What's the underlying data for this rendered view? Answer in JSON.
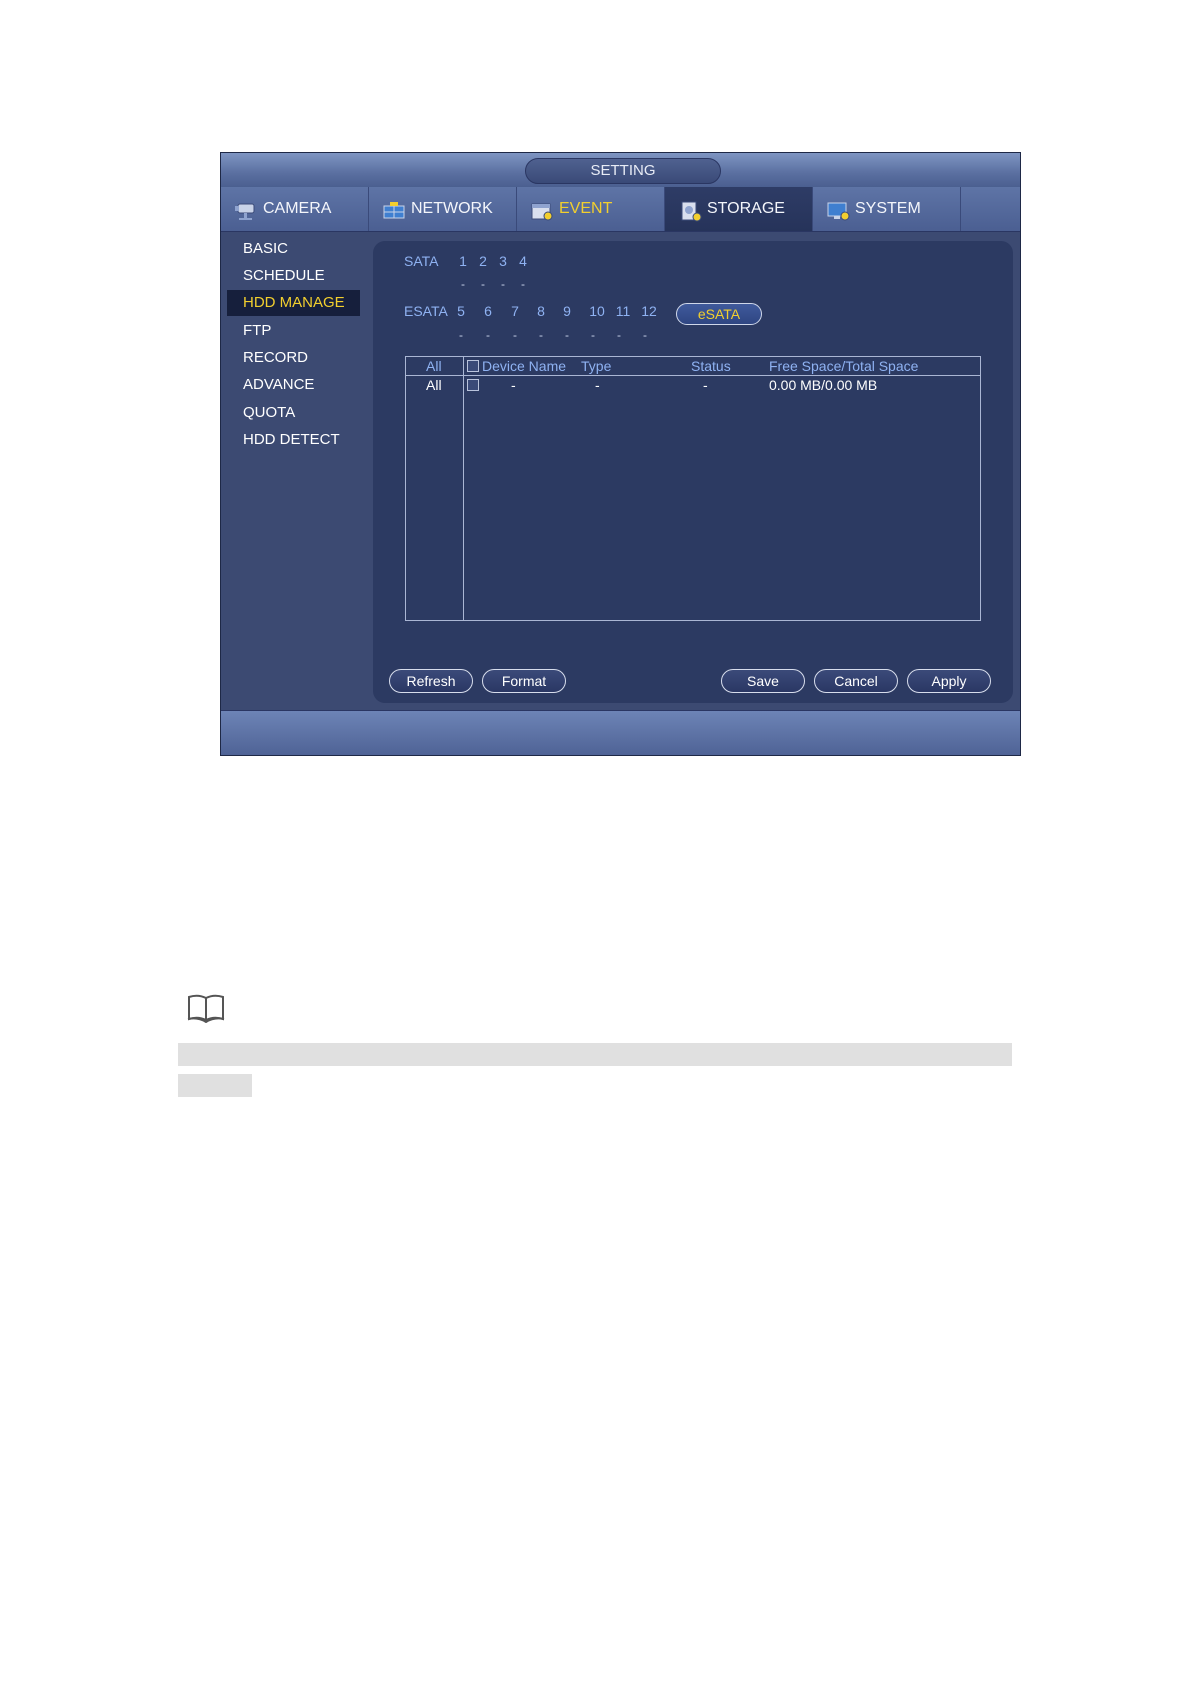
{
  "window": {
    "title": "SETTING"
  },
  "tabs": [
    {
      "label": "CAMERA",
      "icon": "camera-icon"
    },
    {
      "label": "NETWORK",
      "icon": "network-icon"
    },
    {
      "label": "EVENT",
      "icon": "event-icon"
    },
    {
      "label": "STORAGE",
      "icon": "storage-icon",
      "active": true
    },
    {
      "label": "SYSTEM",
      "icon": "system-icon"
    }
  ],
  "menu": [
    {
      "label": "BASIC"
    },
    {
      "label": "SCHEDULE"
    },
    {
      "label": "HDD MANAGE",
      "active": true
    },
    {
      "label": "FTP"
    },
    {
      "label": "RECORD"
    },
    {
      "label": "ADVANCE"
    },
    {
      "label": "QUOTA"
    },
    {
      "label": "HDD DETECT"
    }
  ],
  "sata": {
    "label": "SATA",
    "ports": [
      "1",
      "2",
      "3",
      "4"
    ],
    "status": [
      "-",
      "-",
      "-",
      "-"
    ]
  },
  "esata": {
    "label": "ESATA",
    "ports": [
      "5",
      "6",
      "7",
      "8",
      "9",
      "10",
      "11",
      "12"
    ],
    "status": [
      "-",
      "-",
      "-",
      "-",
      "-",
      "-",
      "-",
      "-"
    ],
    "button_label": "eSATA"
  },
  "table": {
    "headers": {
      "all": "All",
      "device_name": "Device Name",
      "type": "Type",
      "status": "Status",
      "space": "Free Space/Total Space"
    },
    "rows": [
      {
        "all": "All",
        "device_name": "-",
        "type": "-",
        "status": "-",
        "space": "0.00 MB/0.00 MB"
      }
    ]
  },
  "buttons": {
    "refresh": "Refresh",
    "format": "Format",
    "save": "Save",
    "cancel": "Cancel",
    "apply": "Apply"
  },
  "colors": {
    "panel_bg": "#2c3a62",
    "label_blue": "#8fb2f2",
    "highlight_yellow": "#f2cf2e"
  },
  "note": {
    "icon": "book-icon"
  }
}
